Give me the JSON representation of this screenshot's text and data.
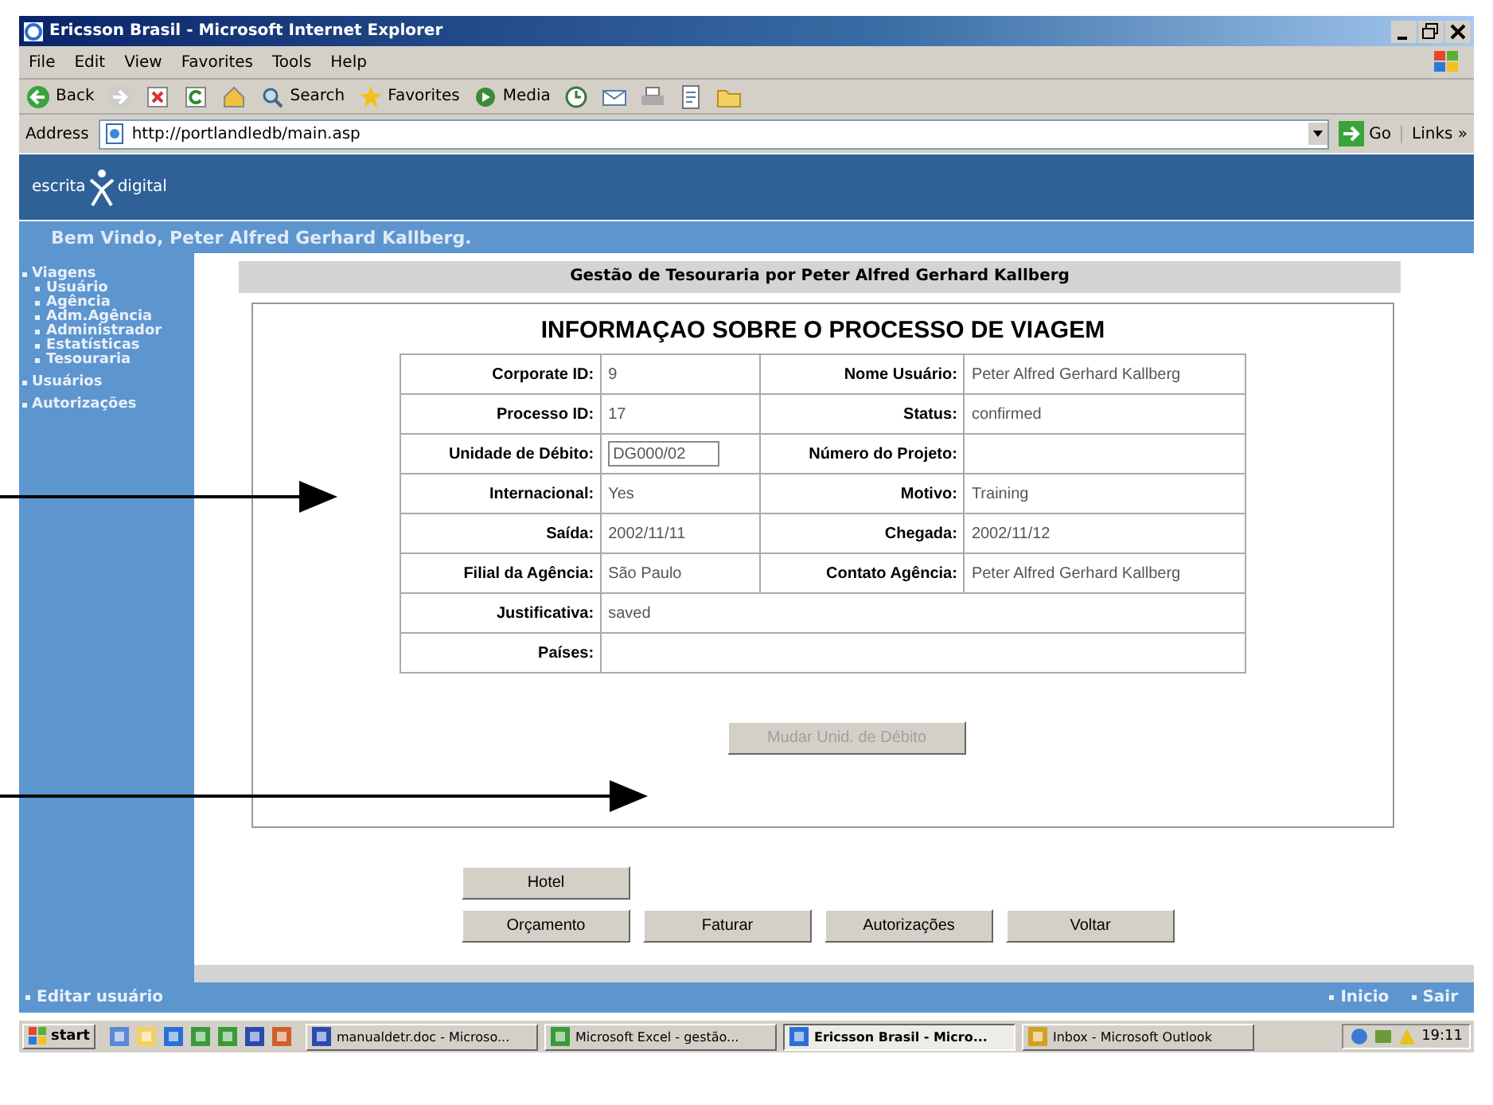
{
  "window": {
    "title": "Ericsson Brasil - Microsoft Internet Explorer"
  },
  "menu": [
    "File",
    "Edit",
    "View",
    "Favorites",
    "Tools",
    "Help"
  ],
  "toolbar": [
    {
      "kind": "back",
      "label": "Back"
    },
    {
      "kind": "forward"
    },
    {
      "kind": "stop"
    },
    {
      "kind": "refresh"
    },
    {
      "kind": "home"
    },
    {
      "kind": "search",
      "label": "Search"
    },
    {
      "kind": "favorites",
      "label": "Favorites"
    },
    {
      "kind": "media",
      "label": "Media"
    },
    {
      "kind": "history"
    },
    {
      "kind": "mail"
    },
    {
      "kind": "print"
    },
    {
      "kind": "edit"
    },
    {
      "kind": "folder"
    }
  ],
  "address": {
    "label": "Address",
    "value": "http://portlandledb/main.asp",
    "go": "Go",
    "links": "Links »"
  },
  "site": {
    "logo_left": "escrita",
    "logo_right": "digital",
    "welcome": "Bem Vindo, Peter Alfred Gerhard Kallberg."
  },
  "nav": [
    {
      "label": "Viagens",
      "children": [
        {
          "label": "Usuário"
        },
        {
          "label": "Agência"
        },
        {
          "label": "Adm.Agência"
        },
        {
          "label": "Administrador"
        },
        {
          "label": "Estatísticas"
        },
        {
          "label": "Tesouraria"
        }
      ]
    },
    {
      "label": "Usuários"
    },
    {
      "label": "Autorizações"
    }
  ],
  "heading": "Gestão de Tesouraria por Peter Alfred Gerhard Kallberg",
  "panel_title": "INFORMAÇAO SOBRE O PROCESSO DE VIAGEM",
  "rows": [
    [
      {
        "label": "Corporate ID:",
        "value": "9"
      },
      {
        "label": "Nome Usuário:",
        "value": "Peter Alfred Gerhard Kallberg"
      }
    ],
    [
      {
        "label": "Processo ID:",
        "value": "17"
      },
      {
        "label": "Status:",
        "value": "confirmed"
      }
    ],
    [
      {
        "label": "Unidade de Débito:",
        "value": "DG000/02",
        "kind": "input"
      },
      {
        "label": "Número do Projeto:"
      }
    ],
    [
      {
        "label": "Internacional:",
        "value": "Yes"
      },
      {
        "label": "Motivo:",
        "value": "Training"
      }
    ],
    [
      {
        "label": "Saída:",
        "value": "2002/11/11"
      },
      {
        "label": "Chegada:",
        "value": "2002/11/12"
      }
    ],
    [
      {
        "label": "Filial da Agência:",
        "value": "São Paulo"
      },
      {
        "label": "Contato Agência:",
        "value": "Peter Alfred Gerhard Kallberg"
      }
    ],
    [
      {
        "label": "Justificativa:",
        "value": "saved"
      }
    ],
    [
      {
        "label": "Países:"
      }
    ]
  ],
  "action_button": {
    "label": "Mudar Unid. de Débito",
    "disabled": true
  },
  "button_rows": [
    [
      "Hotel"
    ],
    [
      "Orçamento",
      "Faturar",
      "Autorizações",
      "Voltar"
    ]
  ],
  "footer": {
    "left": "Editar usuário",
    "right": [
      "Inicio",
      "Sair"
    ]
  },
  "taskbar": {
    "start": "start",
    "tasks": [
      {
        "label": "manualdetr.doc - Microso...",
        "kind": "word",
        "selected": false
      },
      {
        "label": "Microsoft Excel - gestão...",
        "kind": "excel",
        "selected": false
      },
      {
        "label": "Ericsson Brasil - Micro...",
        "kind": "ie",
        "selected": true
      },
      {
        "label": "Inbox - Microsoft Outlook",
        "kind": "outlook",
        "selected": false
      }
    ],
    "clock": "19:11"
  }
}
